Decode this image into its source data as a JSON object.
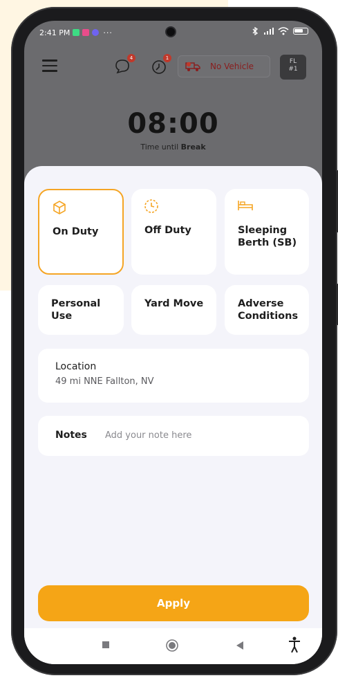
{
  "status_bar": {
    "time": "2:41 PM",
    "dots": "···",
    "notif_colors": [
      "#3ddc84",
      "#e94c8b",
      "#6f63f0"
    ]
  },
  "app_bar": {
    "menu_icon": "hamburger-icon",
    "messages_badge": "4",
    "alerts_badge": "1",
    "vehicle_label": "No Vehicle",
    "fl_line1": "FL",
    "fl_line2": "#1"
  },
  "timer": {
    "value": "08:00",
    "label_prefix": "Time until ",
    "label_bold": "Break"
  },
  "duty_statuses": [
    {
      "label": "On Duty",
      "icon": "cube-icon",
      "selected": true
    },
    {
      "label": "Off Duty",
      "icon": "clock-icon",
      "selected": false
    },
    {
      "label": "Sleeping Berth (SB)",
      "icon": "bed-icon",
      "selected": false
    },
    {
      "label": "Personal Use",
      "selected": false
    },
    {
      "label": "Yard Move",
      "selected": false
    },
    {
      "label": "Adverse Conditions",
      "selected": false
    }
  ],
  "location": {
    "title": "Location",
    "value": "49 mi NNE Fallton, NV"
  },
  "notes": {
    "label": "Notes",
    "placeholder": "Add your note here",
    "value": ""
  },
  "apply_label": "Apply",
  "colors": {
    "accent": "#f5a516",
    "sheet_bg": "#f4f4fa",
    "backdrop": "#6b6b6e",
    "vehicle_text": "#8a1d1d"
  }
}
